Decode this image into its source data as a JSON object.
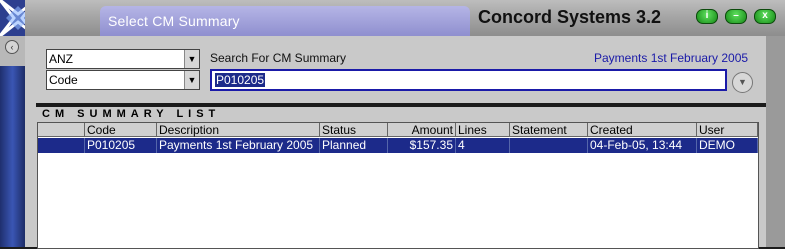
{
  "window": {
    "dialog_title": "Select CM Summary",
    "app_title": "Concord Systems 3.2",
    "buttons": {
      "info_label": "i",
      "minimize_label": "–",
      "close_label": "x"
    }
  },
  "filters": {
    "entity_select": "ANZ",
    "field_select": "Code",
    "search_label": "Search For CM Summary",
    "search_value": "P010205",
    "header_description": "Payments 1st February 2005"
  },
  "list": {
    "title": "CM SUMMARY LIST",
    "columns": [
      "",
      "Code",
      "Description",
      "Status",
      "Amount",
      "Lines",
      "Statement",
      "Created",
      "User"
    ],
    "rows": [
      {
        "selector": "",
        "code": "P010205",
        "description": "Payments 1st February 2005",
        "status": "Planned",
        "amount": "$157.35",
        "lines": "4",
        "statement": "",
        "created": "04-Feb-05, 13:44",
        "user": "DEMO"
      }
    ]
  },
  "colors": {
    "accent": "#1c2a8a",
    "header_text": "#1a1aa8",
    "window_button": "#2db52d"
  }
}
